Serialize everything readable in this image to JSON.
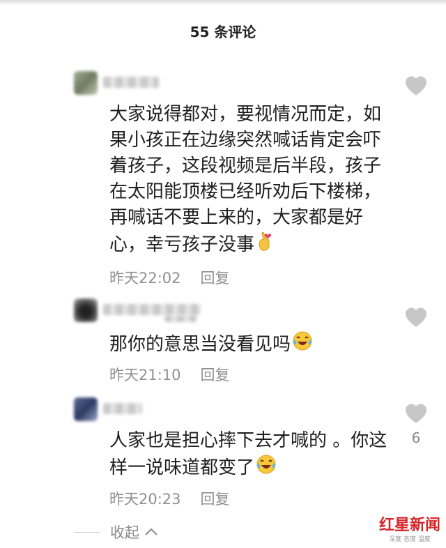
{
  "header": {
    "title": "55 条评论"
  },
  "comments": [
    {
      "text": "大家说得都对，要视情况而定，如果小孩正在边缘突然喊话肯定会吓着孩子，这段视频是后半段，孩子在太阳能顶楼已经听劝后下楼梯，再喊话不要上来的，大家都是好心，幸亏孩子没事",
      "emoji": "finger-heart-emoji",
      "time": "昨天22:02",
      "reply_label": "回复",
      "likes": ""
    },
    {
      "text": "那你的意思当没看见吗",
      "emoji": "laughing-tears-emoji",
      "time": "昨天21:10",
      "reply_label": "回复",
      "likes": ""
    },
    {
      "text": "人家也是担心摔下去才喊的 。你这样一说味道都变了",
      "emoji": "laughing-tears-emoji",
      "time": "昨天20:23",
      "reply_label": "回复",
      "likes": "6"
    }
  ],
  "footer": {
    "collapse_label": "收起",
    "collapse_icon": "chevron-up-icon"
  },
  "watermark": {
    "logo_text": "红星新闻",
    "subtitle": "深度 态度 温度"
  },
  "colors": {
    "text": "#1f1f1f",
    "meta": "#8f8f8f",
    "heart": "#c7c7c7",
    "brand_red": "#d7262a"
  }
}
